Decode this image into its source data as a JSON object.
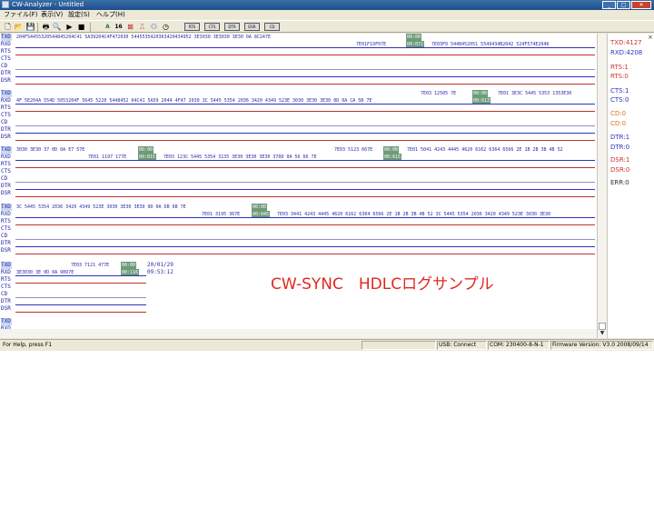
{
  "window": {
    "title": "CW-Analyzer - Untitled",
    "controls": {
      "minimize": "_",
      "maximize": "□",
      "close": "✕"
    }
  },
  "menu": [
    "ファイル(F)",
    "表示(V)",
    "設定(S)",
    "ヘルプ(H)"
  ],
  "toolbar": {
    "font_a": "A",
    "font_16": "16",
    "rts_label": "RTS",
    "cts_label": "CTS",
    "dtr_label": "DTR",
    "dsr_label": "DSR",
    "cd_label": "CD"
  },
  "signal_labels": {
    "txd": "TXD",
    "rxd": "RXD",
    "rts": "RTS",
    "cts": "CTS",
    "cd": "CD",
    "dtr": "DTR",
    "dsr": "DSR"
  },
  "log": {
    "b1": {
      "txd_data": "204F54455320544845204C41 5A39204C4F472030 5445535420363420434952 3E3030 3E3030 3E30 0A 8C247E",
      "txd_time": "00:00",
      "rxd_data": "7E01F19F07E",
      "rxd_time": "00:072",
      "rxd_data2": "7E03F0 5448452051 5549434B2042 524F574E2046"
    },
    "b2": {
      "txd_pre": "7E03 12505 7E",
      "txd_time": "00:00",
      "txd_post": "7E01 3E3C 5445 5353 1353E30",
      "rxd_data": "4F 5E204A 554D 5053204F 5645 5220 5448452 04C41 5A59 2044 4F47 2030 3C 5445 5354 2036 3420 4349 523E 3030 3E30 3E30 0D 0A CA 5B 7E",
      "rxd_time": "00:613"
    },
    "b3": {
      "txd_data": "3030 3E30 37 0D 0A E7 57E",
      "txd_time": "00:00",
      "txd_post": "7E03 5123 667E",
      "txd_time2": "00:00",
      "txd_post2": "7E01 5041 4243 4445 4620 6162 6364 6566 2E 1B 2B 3B 4B 52",
      "rxd_pre": "7E01 1197 177E",
      "rxd_time": "00:015",
      "rxd_post": "7E03 123C 5445 5354 3135 3E30 3E30 3E30 370D 0A 56 66 7E",
      "rxd_time2": "00:615"
    },
    "b4": {
      "txd_data": "3C 5445 5354 2036 3420 4349 523E 3030 3E30 3E30 0D 0A DB 6B 7E",
      "txd_time": "00:00",
      "rxd_pre": "7E01 3195 367E",
      "rxd_time": "00:045",
      "rxd_post": "7E03 3441 4243 4445 4620 6162 6364 6566 2E 1B 2B 3B 4B 52 3C 5445 5354 2036 3420 4349 523E 3030 3E30"
    },
    "b5": {
      "txd_pre": "7E03 7121 477E",
      "txd_time": "00:00",
      "date": "20/01/29",
      "rxd_data": "3E3030 3E 0D 0A 9897E",
      "rxd_time": "00:116",
      "time": "09:53:12"
    }
  },
  "overlay_text": "CW-SYNC　HDLCログサンプル",
  "stats": {
    "txd": "TXD:4127",
    "rxd": "RXD:4208",
    "rts1": "RTS:1",
    "rts0": "RTS:0",
    "cts1": "CTS:1",
    "cts0": "CTS:0",
    "cd0a": "CD:0",
    "cd0b": "CD:0",
    "dtr1": "DTR:1",
    "dtr0": "DTR:0",
    "dsr1": "DSR:1",
    "dsr0": "DSR:0",
    "err": "ERR:0",
    "close": "×"
  },
  "statusbar": {
    "help": "For Help, press F1",
    "usb": "USB: Connect",
    "com": "COM: 230400-8-N-1",
    "firmware": "Firmware Version: V3.0 2008/09/14"
  },
  "colors": {
    "txd_stat": "#d03030",
    "rxd_stat": "#3030c0",
    "overlay": "#e0281e",
    "highlight": "#6e9a78"
  }
}
